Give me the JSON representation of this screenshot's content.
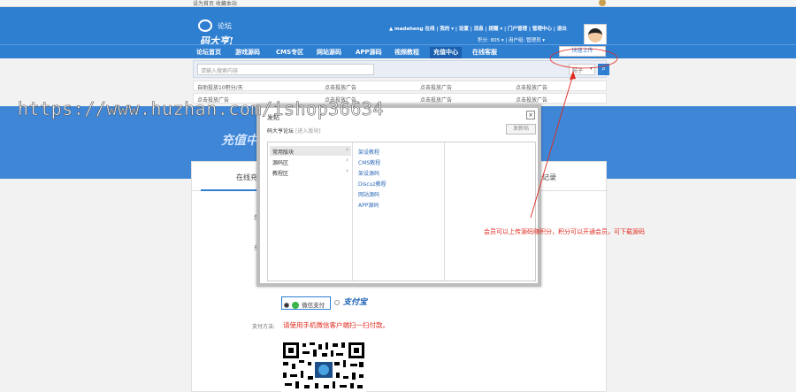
{
  "top": {
    "left_text": "设为首页  收藏本站"
  },
  "logo": {
    "sub": "论坛",
    "main": "码大亨!"
  },
  "user": {
    "line1": "madaheng  在线 | 我的 ▾ | 设置 | 消息 | 提醒 ▾ | 门户管理 | 管理中心 | 退出",
    "line2": "积分: 805 ▾  |  用户组: 管理员 ▾"
  },
  "nav": {
    "items": [
      "论坛首页",
      "游戏源码",
      "CMS专区",
      "网站源码",
      "APP源码",
      "视频教程",
      "充值中心",
      "在线客服"
    ],
    "active_index": 6,
    "upload": "快速上传"
  },
  "search": {
    "placeholder": "请输入搜索内容",
    "type": "帖子",
    "button_icon": "search-icon"
  },
  "ads": {
    "row1": [
      "自助投放10积分/天",
      "点击投放广告",
      "点击投放广告",
      "点击投放广告"
    ],
    "row2": [
      "点击投放广告",
      "点击投放广告",
      "点击投放广告",
      "点击投放广告"
    ]
  },
  "banner": {
    "title": "充值中"
  },
  "content": {
    "tab_online": "在线充值",
    "tab_record": "卡记录",
    "label1": "您",
    "label2": "充"
  },
  "payment": {
    "wechat": "微信支付",
    "alipay": "支付宝",
    "method_label": "支付方法:",
    "method_text": "请使用手机微信客户端扫一扫付款。"
  },
  "modal": {
    "title": "发帖",
    "crumb": "码大亨论坛",
    "crumb_enter": "[进入版块]",
    "new_post": "发新帖",
    "forums": [
      "常用版块",
      "源码区",
      "教程区"
    ],
    "selected_forum": 0,
    "subforums": [
      "架设教程",
      "CMS教程",
      "架设源码",
      "Discuz教程",
      "网站源码",
      "APP源码"
    ]
  },
  "annotation": {
    "text": "会员可以上传源码赚积分，积分可以开通会员，可下载源码"
  },
  "watermark": {
    "text": "https://www.huzhan.com/ishop36634"
  }
}
